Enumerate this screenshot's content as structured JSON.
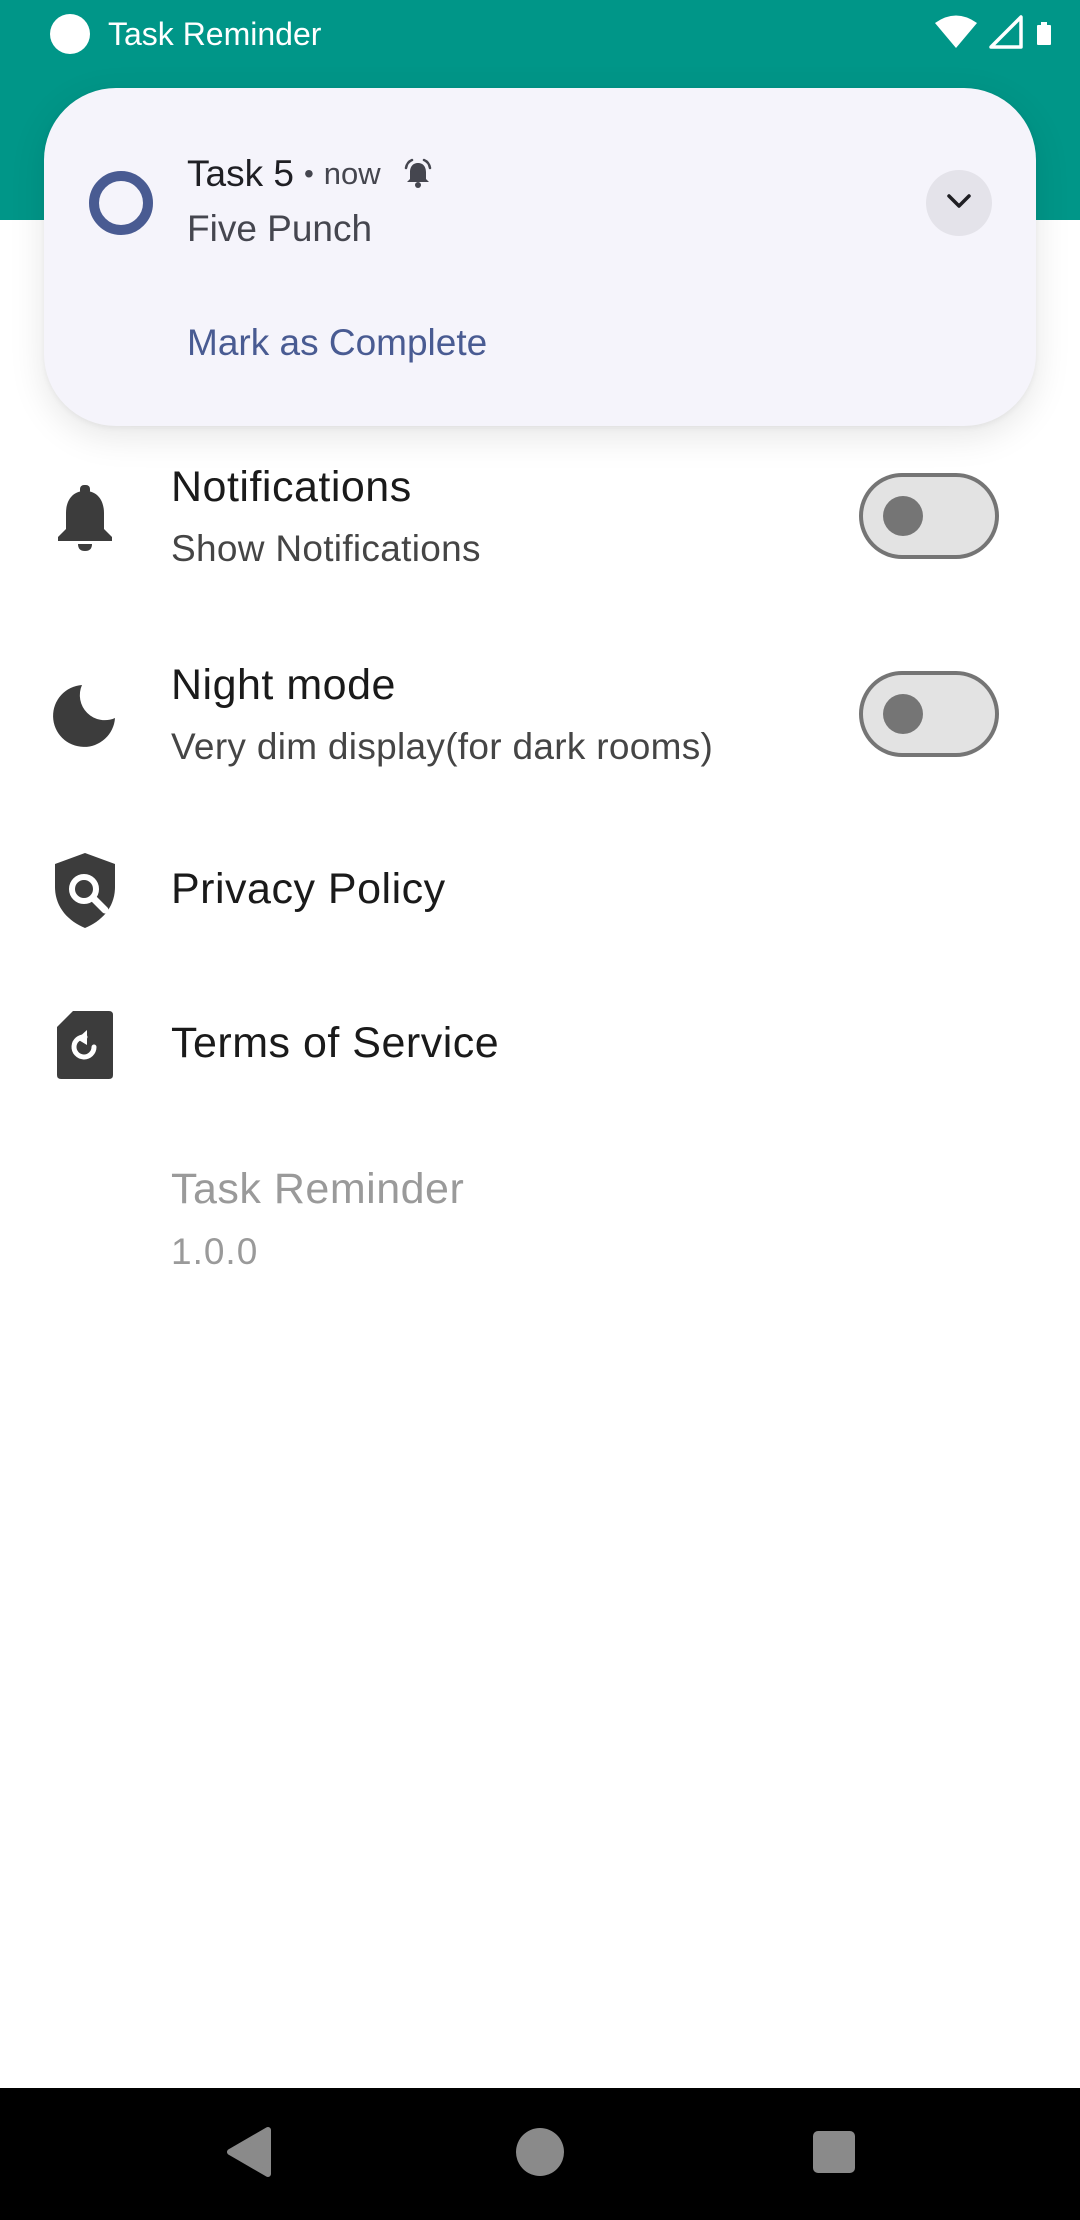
{
  "status_bar": {
    "app_name": "Task Reminder",
    "icons": [
      "app-dot-icon",
      "wifi-icon",
      "cell-signal-icon",
      "battery-icon"
    ]
  },
  "notification": {
    "title": "Task 5",
    "separator": "•",
    "time": "now",
    "text": "Five Punch",
    "action_label": "Mark as Complete",
    "icons": [
      "ring-icon",
      "alarm-bell-icon",
      "chevron-down-icon"
    ]
  },
  "settings": {
    "notifications": {
      "title": "Notifications",
      "subtitle": "Show Notifications",
      "enabled": false,
      "icon": "bell-icon"
    },
    "night_mode": {
      "title": "Night mode",
      "subtitle": "Very dim display(for dark rooms)",
      "enabled": false,
      "icon": "moon-icon"
    },
    "privacy_policy": {
      "title": "Privacy Policy",
      "icon": "shield-search-icon"
    },
    "terms_of_service": {
      "title": "Terms of Service",
      "icon": "document-restore-icon"
    }
  },
  "about": {
    "app_name": "Task Reminder",
    "version": "1.0.0"
  },
  "navigation": {
    "icons": [
      "back-icon",
      "home-icon",
      "recents-icon"
    ]
  },
  "colors": {
    "app_bar": "#009688",
    "notification_bg": "#f5f4fb",
    "notification_accent": "#495b92",
    "toggle_off": "#757575"
  }
}
